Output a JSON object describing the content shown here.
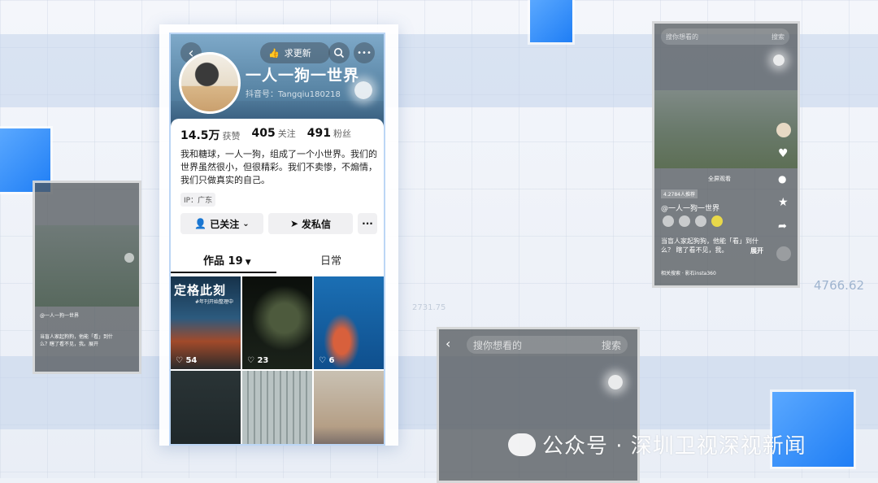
{
  "background": {
    "numbers": [
      "4766.62",
      "2731.75"
    ],
    "accent_color": "#1f7ef5"
  },
  "profile": {
    "back_icon": "chevron-left-icon",
    "request_update_label": "求更新",
    "search_icon": "search-icon",
    "more_icon": "ellipsis-icon",
    "nickname": "一人一狗一世界",
    "douyin_id": "抖音号：Tangqiu180218",
    "stats": [
      {
        "value": "14.5万",
        "label": "获赞"
      },
      {
        "value": "405",
        "label": "关注"
      },
      {
        "value": "491",
        "label": "粉丝"
      }
    ],
    "bio": "我和糖球，一人一狗，组成了一个小世界。我们的世界虽然很小，但很精彩。我们不卖惨，不煽情，我们只做真实的自己。",
    "ip": "IP：广东",
    "follow_button": "已关注",
    "message_button": "发私信",
    "more_button": "···",
    "tabs": [
      {
        "label": "作品 19",
        "active": true
      },
      {
        "label": "日常",
        "active": false
      }
    ],
    "thumbnails": [
      {
        "title": "定格此刻",
        "subtitle": "#年刊开始整理中",
        "likes": "54"
      },
      {
        "title": "",
        "subtitle": "",
        "likes": "23"
      },
      {
        "title": "",
        "subtitle": "",
        "likes": "6"
      },
      {
        "title": "",
        "subtitle": "",
        "likes": ""
      },
      {
        "title": "",
        "subtitle": "",
        "likes": ""
      },
      {
        "title": "",
        "subtitle": "",
        "likes": ""
      }
    ]
  },
  "right_phone": {
    "search_placeholder": "搜你想看的",
    "search_button": "搜索",
    "watching_tag": "全屏观看",
    "recommend_tag": "4.2784人推荐",
    "author": "@一人一狗一世界",
    "caption": "当盲人家起狗狗，他能「看」到什么？ 瞎了看不见，我。",
    "expand": "展开",
    "related": "相关搜索 · 影石insta360"
  },
  "bottom_phone": {
    "search_placeholder": "搜你想看的",
    "search_button": "搜索"
  },
  "left_phone": {
    "author": "@一人一狗一世界",
    "caption": "当盲人家起狗狗，他能「看」到什么？瞎了看不见，我。展开"
  },
  "watermark": {
    "text": "公众号 · 深圳卫视深视新闻"
  }
}
